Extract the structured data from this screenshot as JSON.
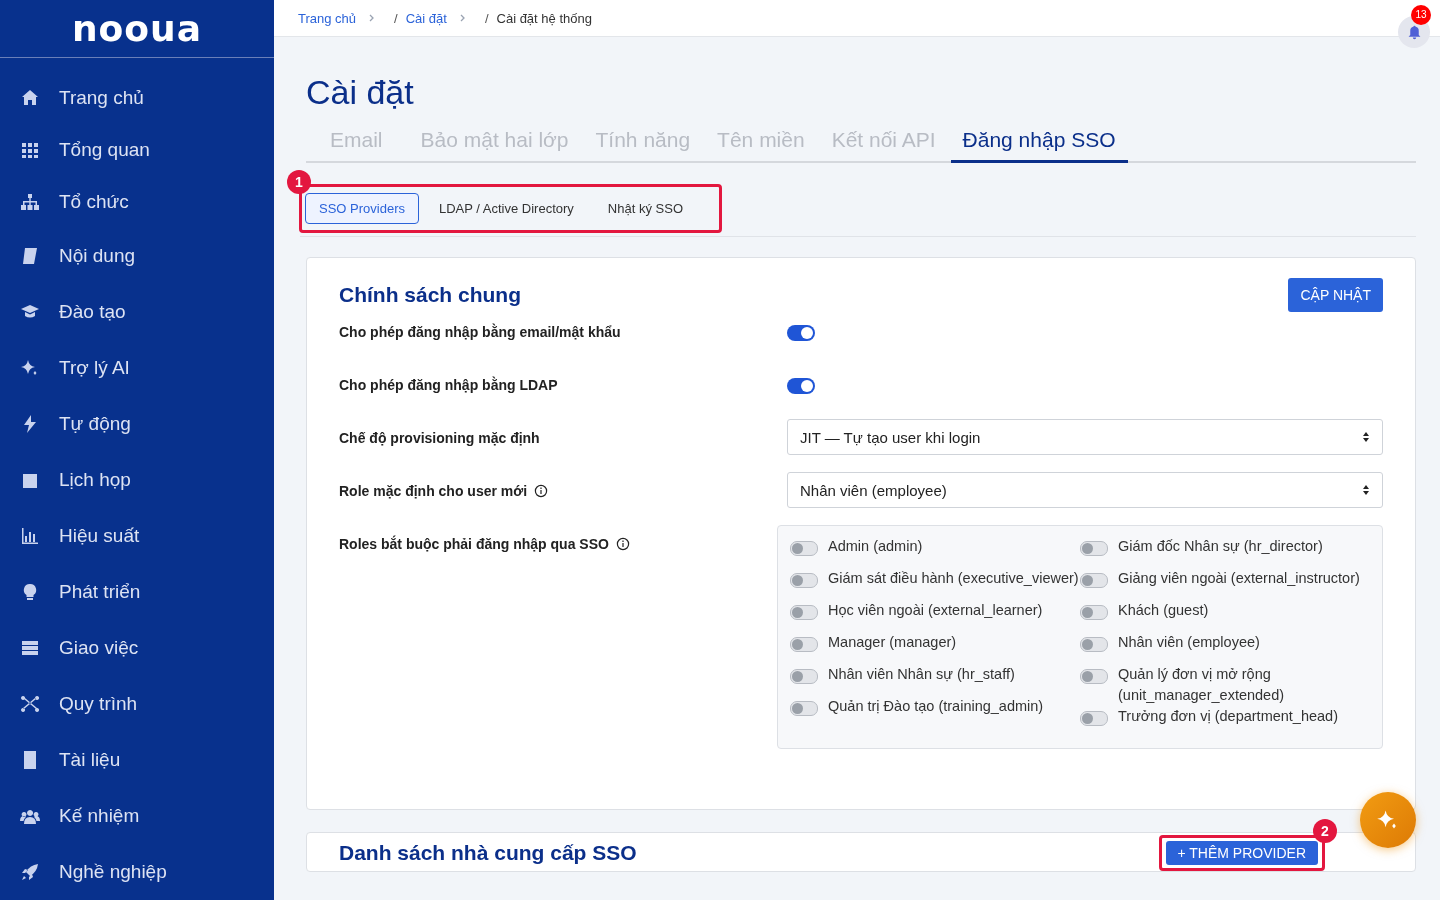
{
  "sidebar": {
    "logo": "nooua",
    "items": [
      {
        "label": "Trang chủ",
        "selected": false
      },
      {
        "label": "Tổng quan",
        "selected": false
      },
      {
        "label": "Tổ chức",
        "selected": false
      },
      {
        "label": "Nội dung",
        "selected": false
      },
      {
        "label": "Đào tạo",
        "selected": false
      },
      {
        "label": "Trợ lý AI",
        "selected": false
      },
      {
        "label": "Tự động",
        "selected": false
      },
      {
        "label": "Lịch họp",
        "selected": false
      },
      {
        "label": "Hiệu suất",
        "selected": false
      },
      {
        "label": "Phát triển",
        "selected": false
      },
      {
        "label": "Giao việc",
        "selected": false
      },
      {
        "label": "Quy trình",
        "selected": false
      },
      {
        "label": "Tài liệu",
        "selected": false
      },
      {
        "label": "Kế nhiệm",
        "selected": false
      },
      {
        "label": "Nghề nghiệp",
        "selected": false
      }
    ]
  },
  "breadcrumb": [
    {
      "label": "Trang chủ",
      "link": true
    },
    {
      "prefix": "/",
      "label": "Cài đặt",
      "link": true
    },
    {
      "prefix": "/",
      "label": "Cài đặt hệ thống",
      "link": false
    }
  ],
  "notifications": {
    "count": "13"
  },
  "page_title": "Cài đặt",
  "tabs": [
    {
      "label": "Email",
      "selected": false
    },
    {
      "label": "Bảo mật hai lớp",
      "selected": false
    },
    {
      "label": "Tính năng",
      "selected": false
    },
    {
      "label": "Tên miền",
      "selected": false
    },
    {
      "label": "Kết nối API",
      "selected": false
    },
    {
      "label": "Đăng nhập SSO",
      "selected": true
    }
  ],
  "subtabs": {
    "annotation": "1",
    "items": [
      {
        "label": "SSO Providers",
        "selected": true
      },
      {
        "label": "LDAP / Active Directory",
        "selected": false
      },
      {
        "label": "Nhật ký SSO",
        "selected": false
      }
    ]
  },
  "policy_card": {
    "title": "Chính sách chung",
    "button": "CẬP NHẬT",
    "rows": [
      {
        "kind": "toggle",
        "label": "Cho phép đăng nhập bằng email/mật khẩu",
        "info": false,
        "on": true
      },
      {
        "kind": "toggle",
        "label": "Cho phép đăng nhập bằng LDAP",
        "info": false,
        "on": true
      },
      {
        "kind": "select",
        "label": "Chế độ provisioning mặc định",
        "info": false,
        "value": "JIT — Tự tạo user khi login"
      },
      {
        "kind": "select",
        "label": "Role mặc định cho user mới",
        "info": true,
        "value": "Nhân viên (employee)"
      },
      {
        "kind": "checklist",
        "label": "Roles bắt buộc phải đăng nhập qua SSO",
        "info": true,
        "options": [
          {
            "label": "Admin (admin)",
            "on": false
          },
          {
            "label": "Giám đốc Nhân sự (hr_director)",
            "on": false
          },
          {
            "label": "Giám sát điều hành (executive_viewer)",
            "on": false
          },
          {
            "label": "Giảng viên ngoài (external_instructor)",
            "on": false
          },
          {
            "label": "Học viên ngoài (external_learner)",
            "on": false
          },
          {
            "label": "Khách (guest)",
            "on": false
          },
          {
            "label": "Manager (manager)",
            "on": false
          },
          {
            "label": "Nhân viên (employee)",
            "on": false
          },
          {
            "label": "Nhân viên Nhân sự (hr_staff)",
            "on": false
          },
          {
            "label": "Quản lý đơn vị mở rộng (unit_manager_extended)",
            "on": false
          },
          {
            "label": "Quản trị Đào tạo (training_admin)",
            "on": false
          },
          {
            "label": "Trưởng đơn vị (department_head)",
            "on": false
          }
        ]
      }
    ]
  },
  "providers_card": {
    "title": "Danh sách nhà cung cấp SSO",
    "button": "+ THÊM PROVIDER",
    "annotation": "2"
  }
}
